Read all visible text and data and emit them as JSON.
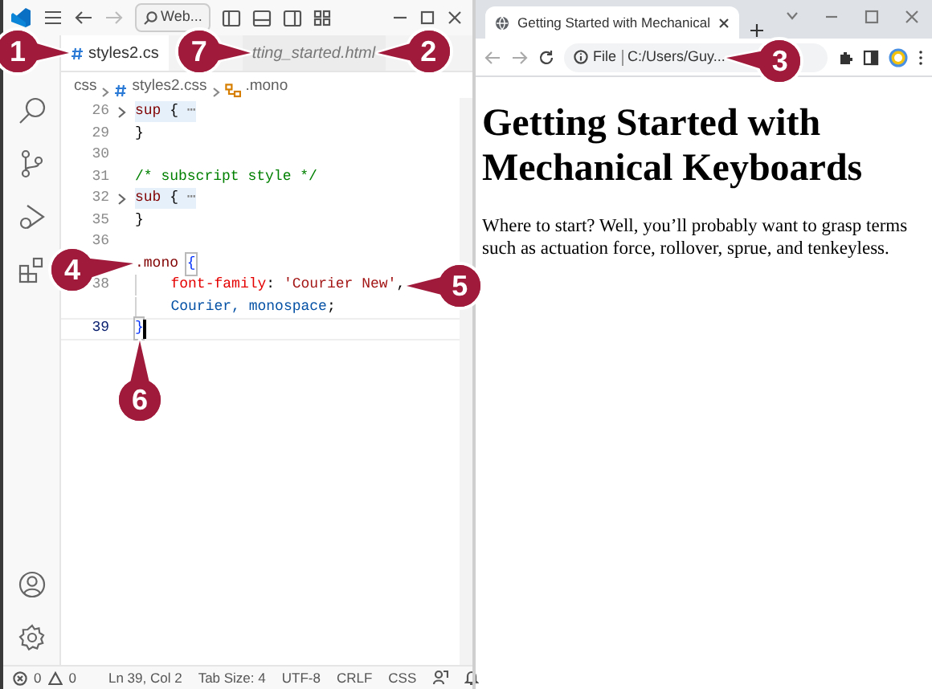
{
  "editor_window": {
    "title_bar": {
      "search_label": "Web..."
    },
    "tabs": [
      {
        "label": "styles2.cs",
        "selected": true
      },
      {
        "label": "tting_started.html",
        "selected": false
      }
    ],
    "breadcrumb": [
      "css",
      "styles2.css",
      ".mono"
    ],
    "code_lines": [
      {
        "number": "26",
        "folded": true,
        "current": false,
        "indented": false,
        "tokens": [
          {
            "kind": "selector",
            "text": "sup"
          },
          {
            "kind": "punct",
            "text": " { "
          },
          {
            "kind": "fold",
            "text": "⋯"
          }
        ]
      },
      {
        "number": "29",
        "folded": false,
        "current": false,
        "indented": false,
        "tokens": [
          {
            "kind": "punct",
            "text": "}"
          }
        ]
      },
      {
        "number": "30",
        "folded": false,
        "current": false,
        "indented": false
      },
      {
        "number": "31",
        "folded": false,
        "current": false,
        "indented": false,
        "tokens": [
          {
            "kind": "comment",
            "text": "/* subscript style */"
          }
        ]
      },
      {
        "number": "32",
        "folded": true,
        "current": false,
        "indented": false,
        "tokens": [
          {
            "kind": "selector",
            "text": "sub"
          },
          {
            "kind": "punct",
            "text": " { "
          },
          {
            "kind": "fold",
            "text": "⋯"
          }
        ]
      },
      {
        "number": "35",
        "folded": false,
        "current": false,
        "indented": false,
        "tokens": [
          {
            "kind": "punct",
            "text": "}"
          }
        ]
      },
      {
        "number": "36",
        "folded": false,
        "current": false,
        "indented": false
      },
      {
        "folded": false,
        "current": false,
        "indented": false,
        "tokens": [
          {
            "kind": "selector",
            "text": ".mono"
          },
          {
            "kind": "brace_match",
            "text": "{"
          }
        ]
      },
      {
        "number": "38",
        "folded": false,
        "current": false,
        "indented": true,
        "tokens": [
          {
            "kind": "property",
            "text": "font-family"
          },
          {
            "kind": "punct",
            "text": ": "
          },
          {
            "kind": "string",
            "text": "'Courier New'"
          },
          {
            "kind": "punct",
            "text": ","
          }
        ]
      },
      {
        "folded": false,
        "current": false,
        "indented": true,
        "tokens": [
          {
            "kind": "value",
            "text": "Courier, monospace"
          },
          {
            "kind": "punct",
            "text": ";"
          }
        ]
      },
      {
        "number": "39",
        "folded": false,
        "current": true,
        "indented": false,
        "tokens": [
          {
            "kind": "brace_match",
            "text": "}"
          }
        ]
      }
    ],
    "status_bar": {
      "errors": "0",
      "warnings": "0",
      "items": [
        "Ln 39, Col 2",
        "Tab Size: 4",
        "UTF-8",
        "CRLF",
        "CSS"
      ]
    }
  },
  "browser_window": {
    "tab": {
      "title": "Getting Started with Mechanical"
    },
    "address": {
      "scheme": "File",
      "url": "C:/Users/Guy..."
    },
    "page": {
      "heading": "Getting Started with Mechanical Keyboards",
      "paragraph": "Where to start? Well, you’ll probably want to grasp terms such as actuation force, rollover, sprue, and tenkeyless."
    }
  },
  "callouts": [
    {
      "number": "1"
    },
    {
      "number": "7"
    },
    {
      "number": "2"
    },
    {
      "number": "3"
    },
    {
      "number": "4"
    },
    {
      "number": "5"
    },
    {
      "number": "6"
    }
  ]
}
